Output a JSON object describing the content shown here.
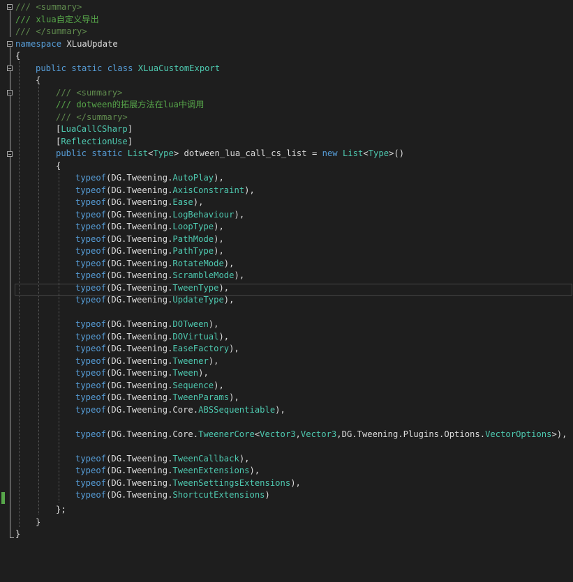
{
  "editor": {
    "namespace": "XLuaUpdate",
    "class_name": "XLuaCustomExport",
    "summary_comment": "/// xlua自定义导出",
    "method_comment": "/// dotween的拓展方法在lua中调用",
    "attribute_1": "LuaCallCSharp",
    "attribute_2": "ReflectionUse",
    "field_name": "dotween_lua_call_cs_list",
    "entries": [
      "AutoPlay",
      "AxisConstraint",
      "Ease",
      "LogBehaviour",
      "LoopType",
      "PathMode",
      "PathType",
      "RotateMode",
      "ScrambleMode",
      "TweenType",
      "UpdateType",
      "DOTween",
      "DOVirtual",
      "EaseFactory",
      "Tweener",
      "Tween",
      "Sequence",
      "TweenParams",
      "Core.ABSSequentiable",
      "Core.TweenerCore<Vector3,Vector3,DG.Tweening.Plugins.Options.VectorOptions>",
      "TweenCallback",
      "TweenExtensions",
      "TweenSettingsExtensions",
      "ShortcutExtensions"
    ]
  }
}
